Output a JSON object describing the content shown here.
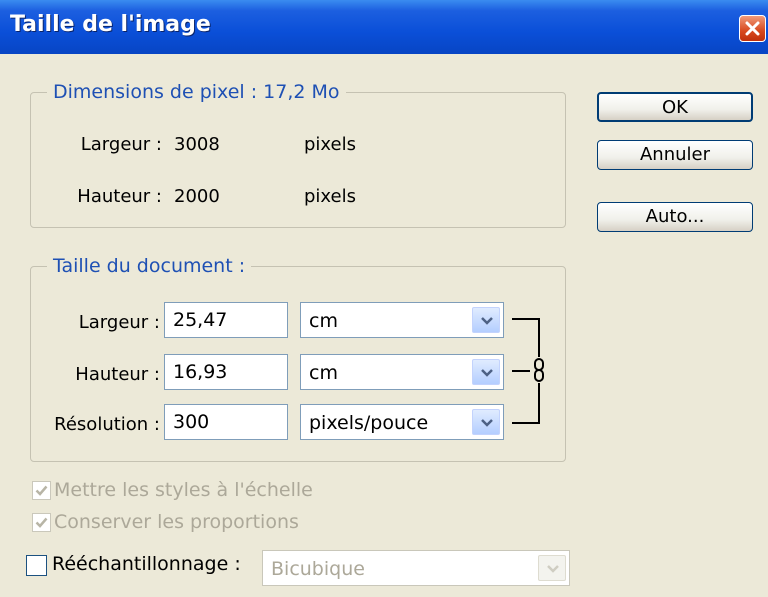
{
  "window": {
    "title": "Taille de l'image"
  },
  "buttons": {
    "ok": "OK",
    "cancel": "Annuler",
    "auto": "Auto..."
  },
  "pixel_dimensions": {
    "legend": "Dimensions de pixel :  17,2 Mo",
    "width_label": "Largeur :",
    "width_value": "3008",
    "width_unit": "pixels",
    "height_label": "Hauteur :",
    "height_value": "2000",
    "height_unit": "pixels"
  },
  "document_size": {
    "legend": "Taille du document :",
    "width_label": "Largeur :",
    "width_value": "25,47",
    "width_unit": "cm",
    "height_label": "Hauteur :",
    "height_value": "16,93",
    "height_unit": "cm",
    "resolution_label": "Résolution :",
    "resolution_value": "300",
    "resolution_unit": "pixels/pouce"
  },
  "options": {
    "scale_styles": {
      "label": "Mettre les styles à l'échelle",
      "checked": true,
      "enabled": false
    },
    "constrain_proportions": {
      "label": "Conserver les proportions",
      "checked": true,
      "enabled": false
    },
    "resample": {
      "label": "Rééchantillonnage :",
      "checked": false,
      "enabled": true
    },
    "resample_method": "Bicubique"
  },
  "icons": {
    "close": "close-icon",
    "link": "chain-link-icon",
    "dropdown": "chevron-down-icon",
    "check": "checkmark-icon"
  },
  "colors": {
    "title_bar": "#0a4fd8",
    "group_legend": "#1e50b4",
    "dialog_bg": "#ece9d8",
    "close_button": "#d8491e"
  }
}
